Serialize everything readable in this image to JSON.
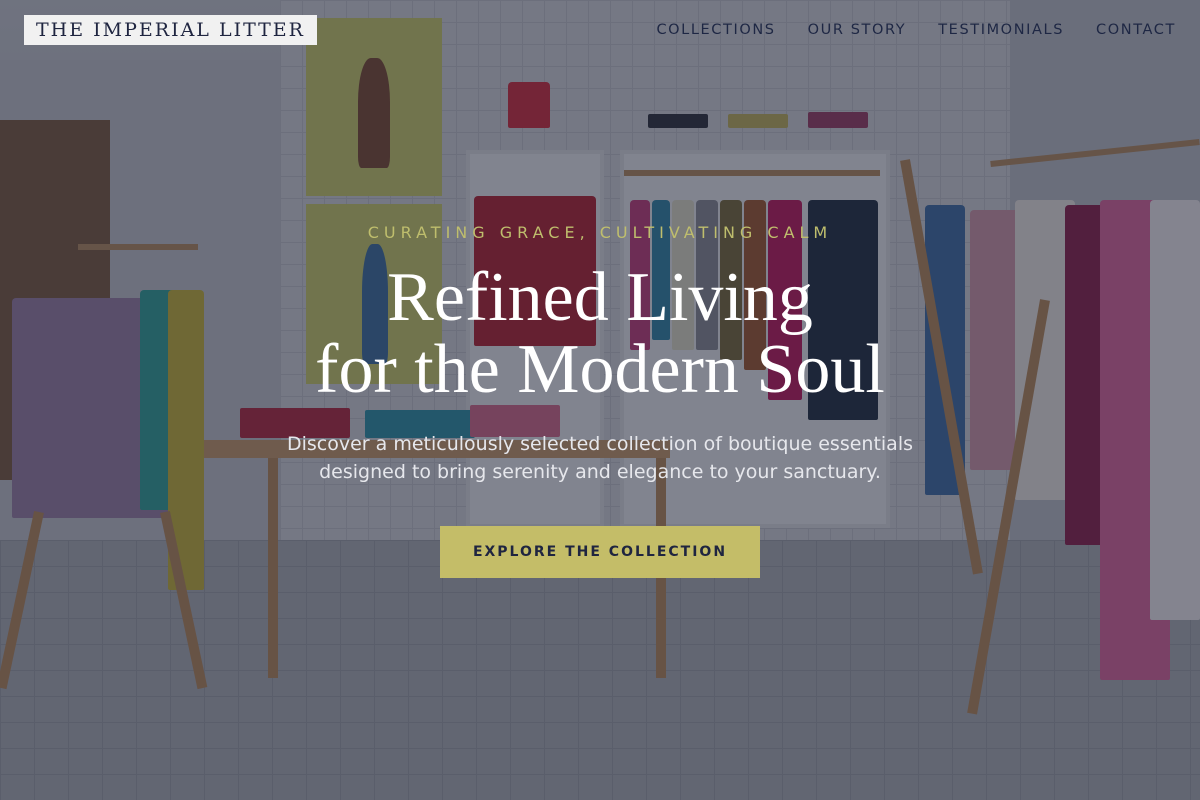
{
  "brand": {
    "name": "THE IMPERIAL LITTER"
  },
  "nav": {
    "items": [
      {
        "label": "COLLECTIONS"
      },
      {
        "label": "OUR STORY"
      },
      {
        "label": "TESTIMONIALS"
      },
      {
        "label": "CONTACT"
      }
    ]
  },
  "hero": {
    "eyebrow": "CURATING GRACE, CULTIVATING CALM",
    "headline_line1": "Refined Living",
    "headline_line2": "for the Modern Soul",
    "subtext_line1": "Discover a meticulously selected collection of boutique essentials",
    "subtext_line2": "designed to bring serenity and elegance to your sanctuary.",
    "cta_label": "EXPLORE THE COLLECTION"
  },
  "colors": {
    "accent": "#c4bd68",
    "navy": "#1f2540",
    "overlay": "rgba(28,32,52,0.52)"
  }
}
